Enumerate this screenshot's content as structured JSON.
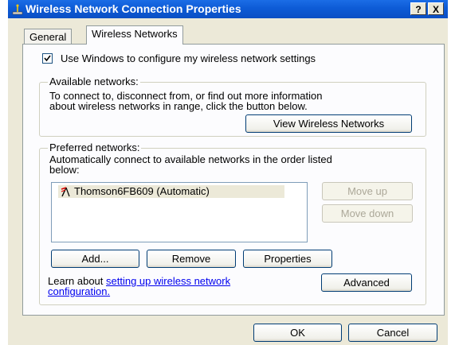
{
  "window": {
    "title": "Wireless Network Connection Properties",
    "help_label": "?",
    "close_label": "X"
  },
  "tabs": [
    {
      "label": "General",
      "active": false
    },
    {
      "label": "Wireless Networks",
      "active": true
    }
  ],
  "use_windows": {
    "label": "Use Windows to configure my wireless network settings",
    "checked": true
  },
  "available": {
    "legend": "Available networks:",
    "text_line1": "To connect to, disconnect from, or find out more information",
    "text_line2": "about wireless networks in range, click the button below.",
    "view_button": "View Wireless Networks"
  },
  "preferred": {
    "legend": "Preferred networks:",
    "text_line1": "Automatically connect to available networks in the order listed",
    "text_line2": "below:",
    "networks": [
      "Thomson6FB609 (Automatic)"
    ],
    "move_up": "Move up",
    "move_down": "Move down",
    "add": "Add...",
    "remove": "Remove",
    "properties": "Properties",
    "learn_text": "Learn about ",
    "learn_link_1": "setting up wireless network",
    "learn_link_2": "configuration.",
    "advanced": "Advanced"
  },
  "footer": {
    "ok": "OK",
    "cancel": "Cancel"
  }
}
